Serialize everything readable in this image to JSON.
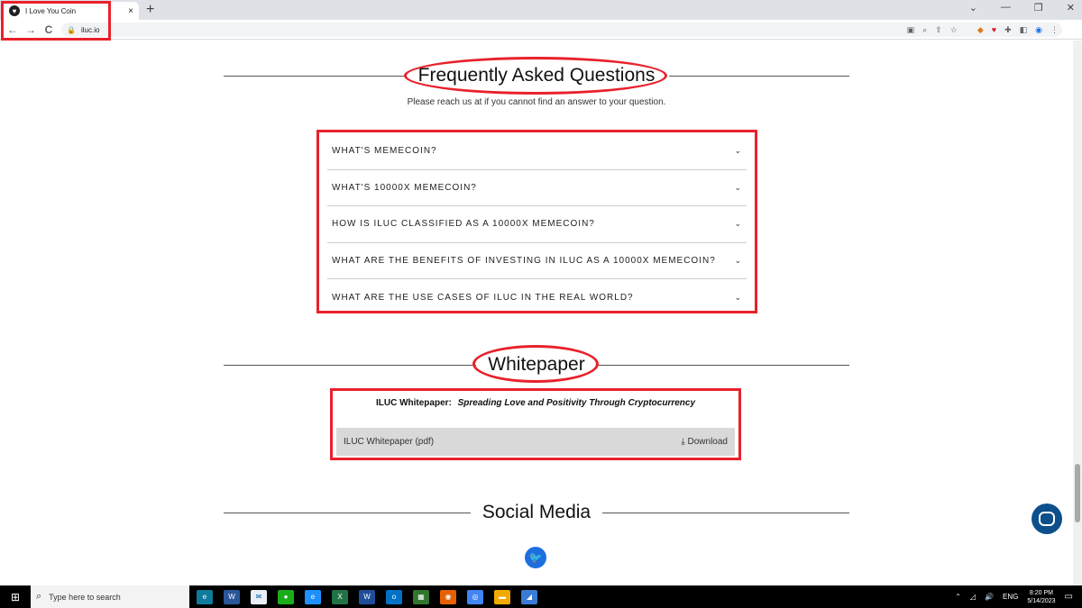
{
  "browser": {
    "tab_title": "I Love You Coin",
    "tab_close": "×",
    "new_tab": "+",
    "url": "iluc.io",
    "back": "←",
    "forward": "→",
    "reload": "C",
    "win_min": "—",
    "win_restore": "❐",
    "win_close": "✕",
    "win_chevron": "⌄"
  },
  "faq": {
    "title": "Frequently Asked Questions",
    "subtitle": "Please reach us at  if you cannot find an answer to your question.",
    "items": [
      "WHAT'S MEMECOIN?",
      "WHAT'S 10000X MEMECOIN?",
      "HOW IS ILUC CLASSIFIED AS A 10000X MEMECOIN?",
      "WHAT ARE THE BENEFITS OF INVESTING IN ILUC AS A 10000X MEMECOIN?",
      "WHAT ARE THE USE CASES OF ILUC IN THE REAL WORLD?"
    ]
  },
  "whitepaper": {
    "title": "Whitepaper",
    "heading_label": "ILUC Whitepaper:",
    "heading_tagline": "Spreading Love and Positivity Through Cryptocurrency",
    "file_label": "ILUC Whitepaper (pdf)",
    "download_label": "Download",
    "download_glyph": "⤓"
  },
  "social": {
    "title": "Social Media"
  },
  "taskbar": {
    "search_placeholder": "Type here to search",
    "lang": "ENG",
    "time": "8:20 PM",
    "date": "5/14/2023"
  },
  "colors": {
    "annotation_red": "#e8212b",
    "twitter_blue": "#1d6fe0",
    "chat_blue": "#0d4f8b"
  }
}
